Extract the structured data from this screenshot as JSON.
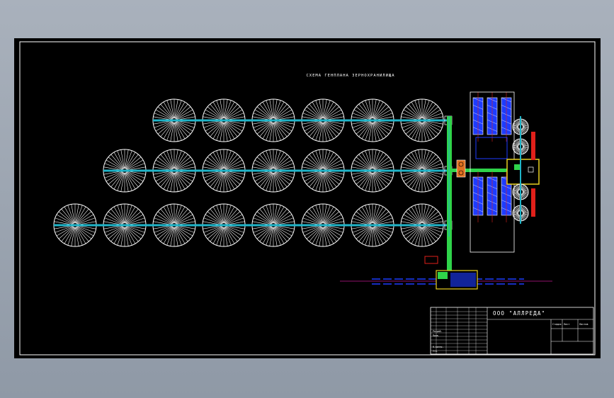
{
  "drawing": {
    "main_title": "СХЕМА ГЕНПЛАНА ЗЕРНОХРАНИЛИЩА",
    "colors": {
      "background": "#000000",
      "frame": "#ffffff",
      "silo": "#ffffff",
      "conveyor": "#1fb4c8",
      "gallery": "#2fd44a",
      "elevator_blue": "#1e3cff",
      "red": "#e0201a",
      "yellow": "#e8d020",
      "orange": "#e07020",
      "magenta": "#c01890"
    },
    "silo_rows": [
      {
        "count": 6
      },
      {
        "count": 7
      },
      {
        "count": 8
      }
    ],
    "icons": [
      "silo-icon",
      "elevator-tower-icon",
      "dryer-icon",
      "small-silo-icon"
    ]
  },
  "title_block": {
    "company": "ООО \"АЛЛРЕДА\"",
    "sheet_code": "Лист",
    "stage": "Стадия",
    "sheets": "Листов",
    "role_1": "Разраб.",
    "role_2": "Пров.",
    "role_3": "Н.контр.",
    "role_4": "Утв."
  }
}
